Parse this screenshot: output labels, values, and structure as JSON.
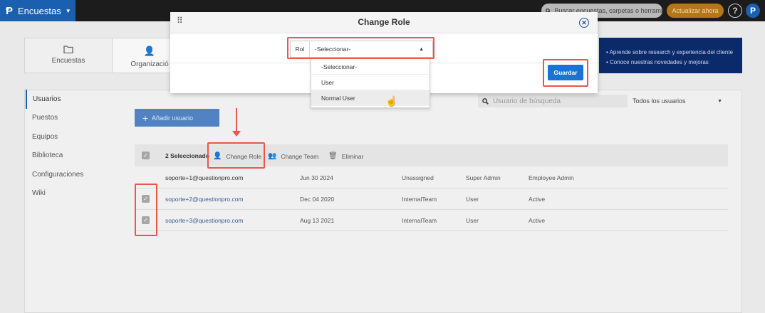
{
  "topbar": {
    "app_name": "Encuestas",
    "search_placeholder": "Buscar encuestas, carpetas o herrami",
    "upgrade_label": "Actualizar ahora",
    "help_label": "?",
    "profile_letter": "P"
  },
  "cards": [
    {
      "label": "Encuestas",
      "icon": "folder-icon"
    },
    {
      "label": "Organizació",
      "icon": "add-user-icon"
    }
  ],
  "banner": {
    "lines": [
      "• Aprende sobre research y experiencia del cliente",
      "• Conoce nuestras novedades y mejoras"
    ]
  },
  "sidebar": {
    "items": [
      "Usuarios",
      "Puestos",
      "Equipos",
      "Biblioteca",
      "Configuraciones",
      "Wiki"
    ]
  },
  "filters": {
    "search_placeholder": "Usuario de búsqueda",
    "user_filter": "Todos los usuarios"
  },
  "add_user_label": "Añadir usuario",
  "toolbar": {
    "selected_count": "2 Seleccionado",
    "change_role": "Change Role",
    "change_team": "Change Team",
    "delete": "Eliminar"
  },
  "users": [
    {
      "email": "soporte+1@questionpro.com",
      "date": "Jun 30 2024",
      "team": "Unassigned",
      "role": "Super Admin",
      "status": "Employee Admin",
      "selected": false
    },
    {
      "email": "soporte+2@questionpro.com",
      "date": "Dec 04 2020",
      "team": "InternalTeam",
      "role": "User",
      "status": "Active",
      "selected": true
    },
    {
      "email": "soporte+3@questionpro.com",
      "date": "Aug 13 2021",
      "team": "InternalTeam",
      "role": "User",
      "status": "Active",
      "selected": true
    }
  ],
  "modal": {
    "title": "Change Role",
    "rol_label": "Rol",
    "selected_value": "-Seleccionar-",
    "options": [
      "-Seleccionar-",
      "User",
      "Normal User"
    ],
    "save_label": "Guardar"
  },
  "colors": {
    "brand": "#1b5fb1",
    "highlight": "#e8574a",
    "save_button": "#1a73d6"
  }
}
